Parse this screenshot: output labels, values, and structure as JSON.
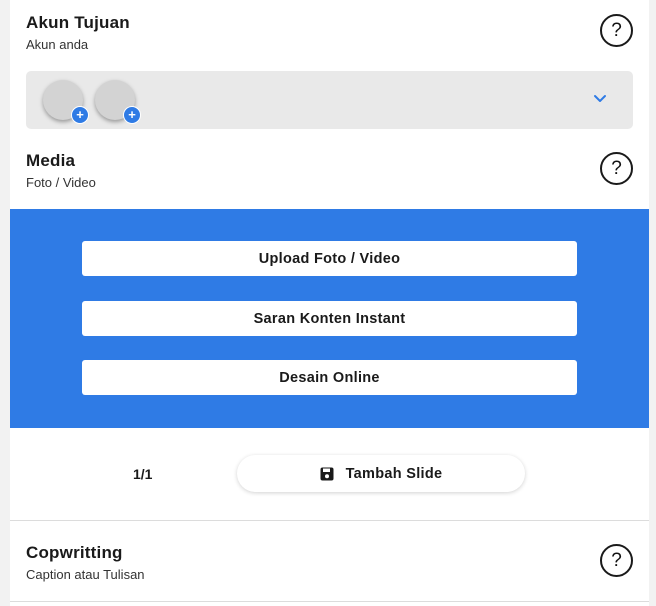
{
  "account_section": {
    "title": "Akun Tujuan",
    "subtitle": "Akun anda",
    "help_icon": "question-mark-icon",
    "avatars": [
      {
        "icon": "add-account-icon",
        "badge": "+"
      },
      {
        "icon": "add-account-icon",
        "badge": "+"
      }
    ],
    "dropdown_icon": "chevron-down-icon"
  },
  "media_section": {
    "title": "Media",
    "subtitle": "Foto / Video",
    "help_icon": "question-mark-icon",
    "buttons": [
      {
        "label": "Upload Foto / Video"
      },
      {
        "label": "Saran Konten Instant"
      },
      {
        "label": "Desain Online"
      }
    ]
  },
  "slides": {
    "counter": "1/1",
    "add_label": "Tambah Slide",
    "add_icon": "save-icon"
  },
  "copywriting_section": {
    "title": "Copwritting",
    "subtitle": "Caption atau Tulisan",
    "help_icon": "question-mark-icon"
  },
  "help_glyph": "?",
  "colors": {
    "accent": "#2f7be5",
    "background": "#f2f2f2",
    "card": "#ffffff",
    "account_box": "#e9e9e9"
  }
}
